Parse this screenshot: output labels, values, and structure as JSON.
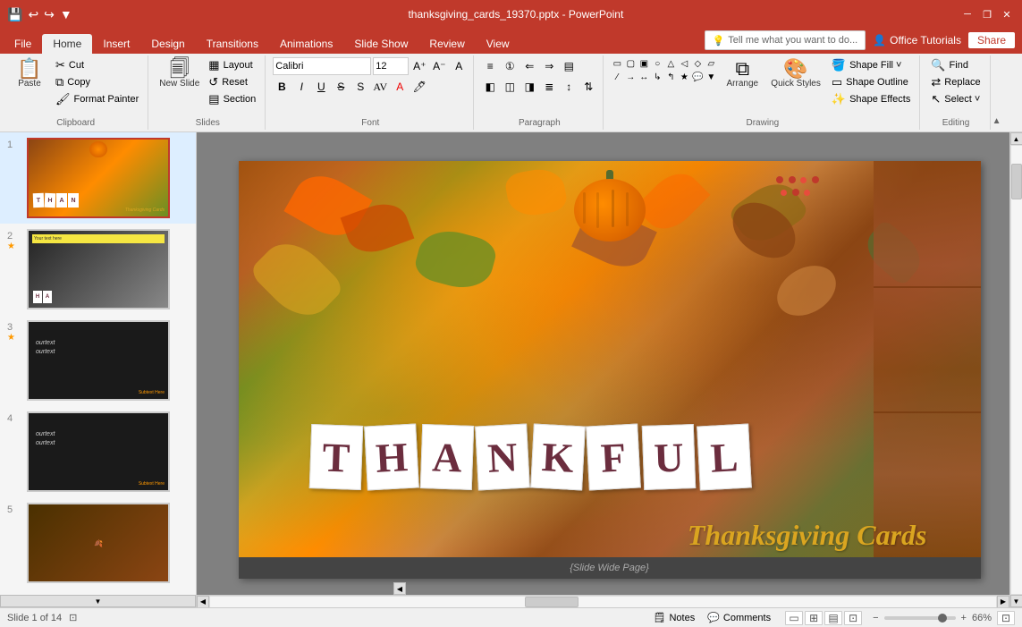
{
  "titlebar": {
    "title": "thanksgiving_cards_19370.pptx - PowerPoint",
    "save_icon": "💾",
    "undo_icon": "↩",
    "redo_icon": "↪",
    "customize_icon": "▼",
    "minimize": "─",
    "restore": "❐",
    "close": "✕"
  },
  "ribbon_tabs": {
    "tabs": [
      "File",
      "Home",
      "Insert",
      "Design",
      "Transitions",
      "Animations",
      "Slide Show",
      "Review",
      "View"
    ],
    "active": "Home"
  },
  "ribbon": {
    "clipboard": {
      "label": "Clipboard",
      "paste_label": "Paste",
      "cut_label": "Cut",
      "copy_label": "Copy",
      "format_painter_label": "Format Painter"
    },
    "slides": {
      "label": "Slides",
      "new_slide_label": "New\nSlide",
      "layout_label": "Layout",
      "reset_label": "Reset",
      "section_label": "Section"
    },
    "font": {
      "label": "Font",
      "font_name": "Calibri",
      "font_size": "12",
      "bold": "B",
      "italic": "I",
      "underline": "U",
      "strikethrough": "S",
      "shadow": "s",
      "increase": "A↑",
      "decrease": "A↓",
      "clear": "A"
    },
    "paragraph": {
      "label": "Paragraph"
    },
    "drawing": {
      "label": "Drawing",
      "arrange_label": "Arrange",
      "quick_styles_label": "Quick\nStyles",
      "shape_fill_label": "Shape Fill ˅",
      "shape_outline_label": "Shape Outline",
      "shape_effects_label": "Shape Effects"
    },
    "editing": {
      "label": "Editing",
      "find_label": "Find",
      "replace_label": "Replace",
      "select_label": "Select ˅"
    }
  },
  "tell_me": {
    "placeholder": "Tell me what you want to do...",
    "icon": "💡"
  },
  "office_tutorials": {
    "label": "Office Tutorials",
    "icon": "👤"
  },
  "share_btn": "Share",
  "slides": [
    {
      "num": "1",
      "starred": false,
      "active": true
    },
    {
      "num": "2",
      "starred": true,
      "active": false
    },
    {
      "num": "3",
      "starred": true,
      "active": false
    },
    {
      "num": "4",
      "starred": false,
      "active": false
    },
    {
      "num": "5",
      "starred": false,
      "active": false
    }
  ],
  "slide": {
    "thankful_letters": [
      "T",
      "H",
      "A",
      "N",
      "K",
      "F",
      "U",
      "L"
    ],
    "thanksgiving_text": "Thanksgiving Cards",
    "footer_text": "{Slide Wide Page}"
  },
  "status_bar": {
    "slide_info": "Slide 1 of 14",
    "notes_label": "Notes",
    "comments_label": "Comments",
    "zoom_level": "66%",
    "fit_icon": "⊡"
  }
}
